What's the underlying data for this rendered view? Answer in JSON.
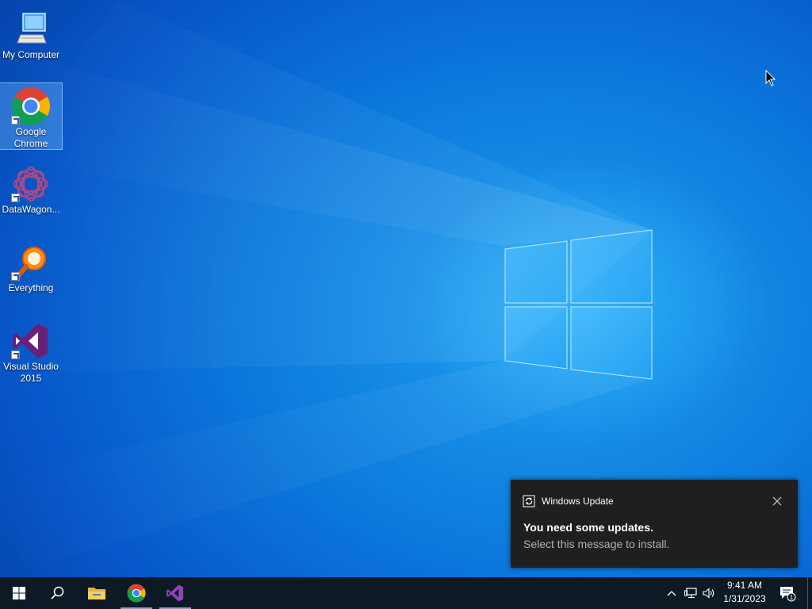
{
  "desktop": {
    "icons": [
      {
        "label": "My Computer"
      },
      {
        "label": "Google Chrome"
      },
      {
        "label": "DataWagon..."
      },
      {
        "label": "Everything"
      },
      {
        "label": "Visual Studio 2015"
      }
    ]
  },
  "notification": {
    "app_name": "Windows Update",
    "title": "You need some updates.",
    "body": "Select this message to install."
  },
  "taskbar": {
    "pinned": [
      "start-icon",
      "search-icon",
      "file-explorer-icon",
      "chrome-icon",
      "visual-studio-icon"
    ],
    "clock_time": "9:41 AM",
    "clock_date": "1/31/2023",
    "notification_count": "1"
  }
}
